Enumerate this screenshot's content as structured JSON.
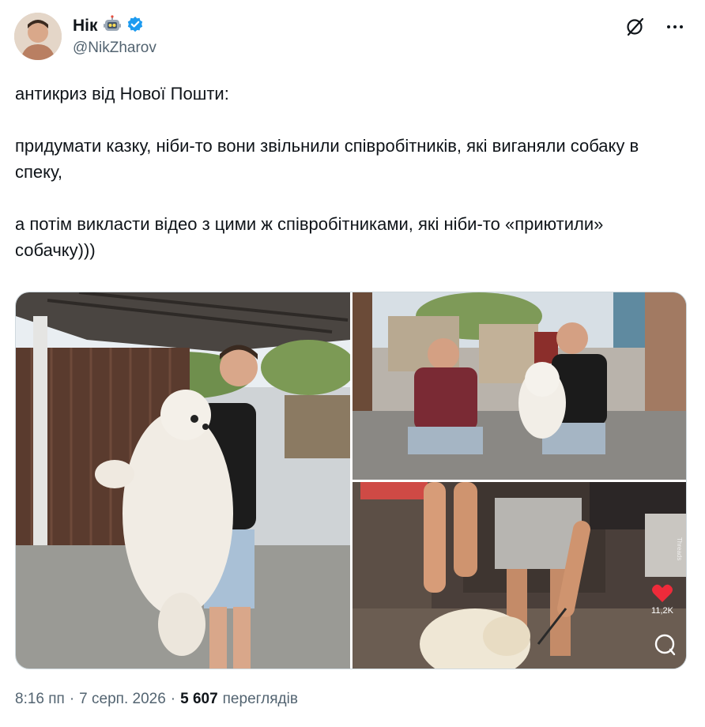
{
  "author": {
    "display_name": "Нік",
    "handle": "@NikZharov",
    "emoji_icon": "robot-emoji",
    "verified_color": "#1d9bf0"
  },
  "tweet": {
    "lines": [
      "антикриз від Нової Пошти:",
      "придумати казку, ніби-то вони звільнили співробітників, які виганяли собаку в спеку,",
      "а потім викласти відео з цими ж співробітниками, які ніби-то «приютили» собачку)))"
    ]
  },
  "media": {
    "video_overlay": {
      "like_count": "11,2K",
      "watermark": "Threads"
    }
  },
  "footer": {
    "time": "8:16 пп",
    "separator": "·",
    "date": "7 серп. 2026",
    "separator2": "·",
    "views_count": "5 607",
    "views_label": "переглядів"
  }
}
